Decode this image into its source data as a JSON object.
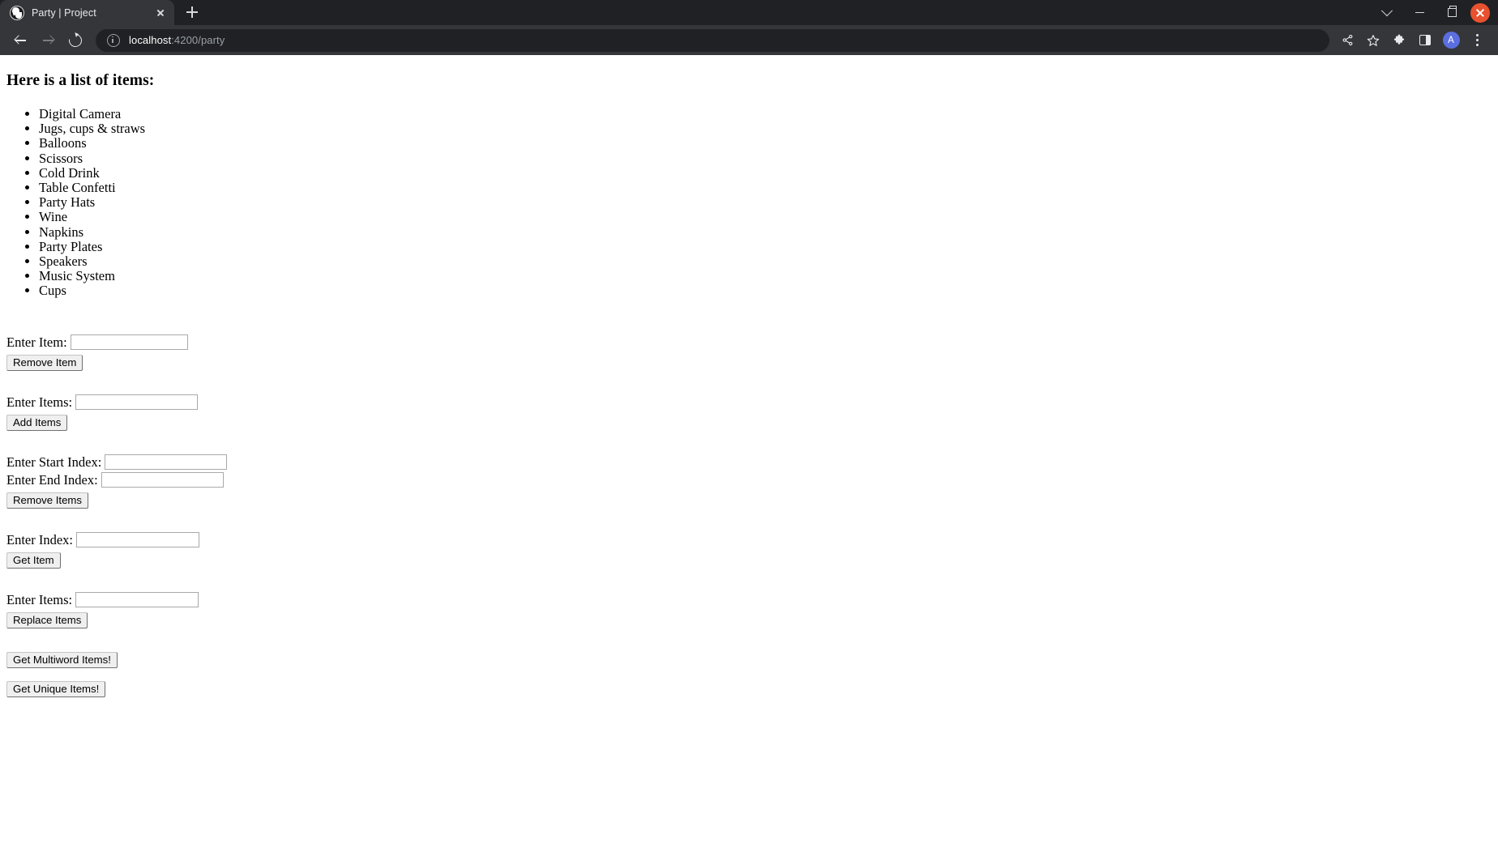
{
  "browser": {
    "tab": {
      "title": "Party | Project",
      "favicon_name": "angular-shield-icon",
      "close_label": "×"
    },
    "new_tab_label": "+",
    "window_controls": {
      "tab_search": "chevron-down-icon",
      "minimize": "minimize-icon",
      "maximize": "maximize-icon",
      "close": "close-icon",
      "close_color": "#e8512f"
    },
    "toolbar": {
      "back": "back-arrow-icon",
      "forward": "forward-arrow-icon",
      "reload": "reload-icon",
      "site_info": "info-icon",
      "url_host": "localhost",
      "url_path": ":4200/party",
      "url_full": "localhost:4200/party",
      "icons": [
        {
          "name": "share-icon",
          "glyph": "➤"
        },
        {
          "name": "bookmark-star-icon",
          "glyph": "☆"
        },
        {
          "name": "extensions-puzzle-icon",
          "glyph": "🧩"
        },
        {
          "name": "side-panel-icon",
          "glyph": "▣"
        }
      ],
      "avatar_letter": "A",
      "avatar_color": "#5b6ee0",
      "menu": "three-dot-menu-icon"
    }
  },
  "page": {
    "heading": "Here is a list of items:",
    "items": [
      "Digital Camera",
      "Jugs, cups & straws",
      "Balloons",
      "Scissors",
      "Cold Drink",
      "Table Confetti",
      "Party Hats",
      "Wine",
      "Napkins",
      "Party Plates",
      "Speakers",
      "Music System",
      "Cups"
    ],
    "forms": {
      "remove_item": {
        "label": "Enter Item:",
        "value": "",
        "placeholder": "",
        "button": "Remove Item"
      },
      "add_items": {
        "label": "Enter Items:",
        "value": "",
        "placeholder": "",
        "button": "Add Items"
      },
      "remove_range": {
        "start_label": "Enter Start Index:",
        "start_value": "",
        "end_label": "Enter End Index:",
        "end_value": "",
        "button": "Remove Items"
      },
      "get_item": {
        "label": "Enter Index:",
        "value": "",
        "button": "Get Item"
      },
      "replace_items": {
        "label": "Enter Items:",
        "value": "",
        "button": "Replace Items"
      },
      "multiword_button": "Get Multiword Items!",
      "unique_button": "Get Unique Items!"
    }
  }
}
